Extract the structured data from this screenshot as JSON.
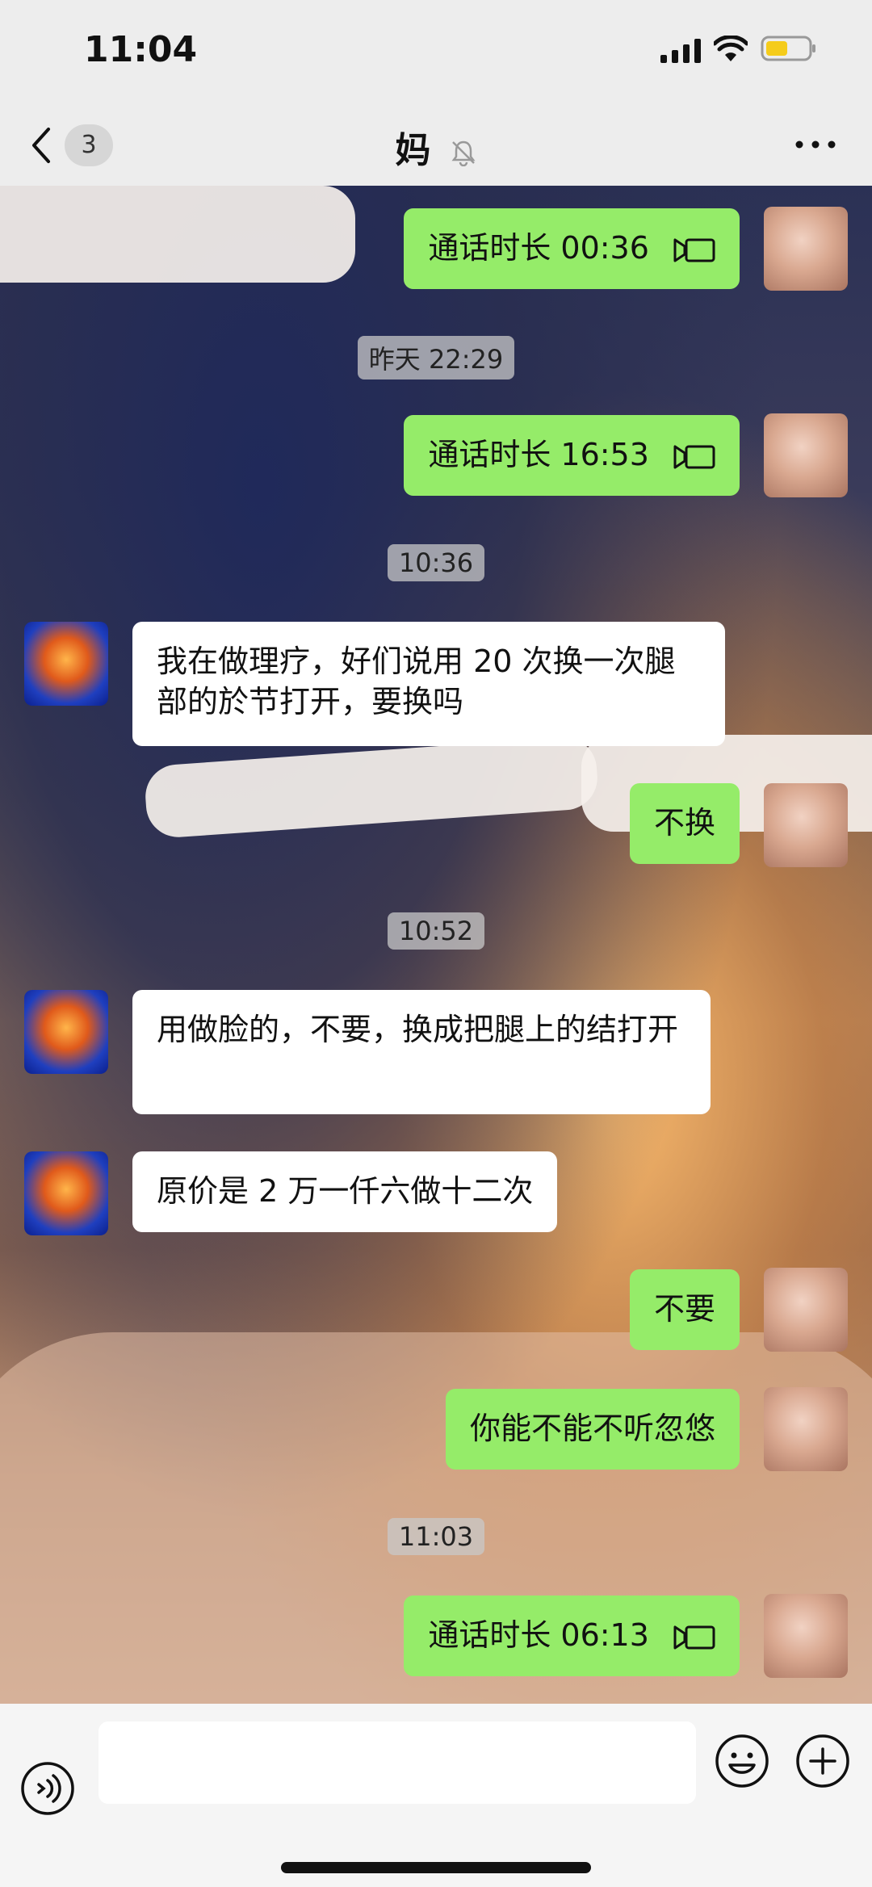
{
  "status_bar": {
    "time": "11:04"
  },
  "nav": {
    "unread_count": "3",
    "title": "妈"
  },
  "messages": [
    {
      "text": "通话时长 00:36"
    },
    {
      "timestamp": "昨天 22:29"
    },
    {
      "text": "通话时长 16:53"
    },
    {
      "timestamp": "10:36"
    },
    {
      "text": "我在做理疗，好们说用 20 次换一次腿部的於节打开，要换吗"
    },
    {
      "text": "不换"
    },
    {
      "timestamp": "10:52"
    },
    {
      "text": "用做脸的，不要，换成把腿上的结打开"
    },
    {
      "text": "原价是 2 万一仟六做十二次"
    },
    {
      "text": "不要"
    },
    {
      "text": "你能不能不听忽悠"
    },
    {
      "timestamp": "11:03"
    },
    {
      "text": "通话时长 06:13"
    }
  ],
  "colors": {
    "outgoing_bubble": "#95ec69",
    "incoming_bubble": "#ffffff",
    "background": "#ededed"
  }
}
